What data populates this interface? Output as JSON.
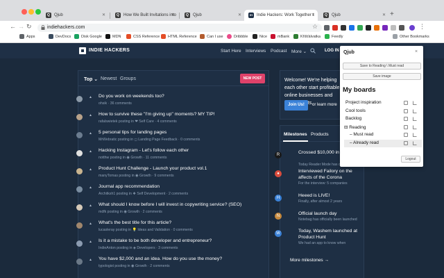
{
  "browser": {
    "tabs": [
      {
        "label": "Qjub",
        "fav_color": "#3b3b3b",
        "fav_text": "Q"
      },
      {
        "label": "How We Built Invitations into",
        "fav_color": "#3b3b3b",
        "fav_text": "Q"
      },
      {
        "label": "Qjub",
        "fav_color": "#3b3b3b",
        "fav_text": "Q"
      },
      {
        "label": "Indie Hackers: Work Together t",
        "fav_color": "#1f3046",
        "fav_text": "IH"
      },
      {
        "label": "Qjub",
        "fav_color": "#3b3b3b",
        "fav_text": "Q"
      }
    ],
    "active_tab": 3,
    "url": "indiehackers.com",
    "nav": {
      "back": "←",
      "forward": "→",
      "reload": "↻",
      "home": "⌂",
      "star": "☆",
      "menu": "⋮"
    },
    "bookmarks": [
      {
        "label": "Apps",
        "color": "#5f6368"
      },
      {
        "label": "DevDocs",
        "color": "#3a4b5e"
      },
      {
        "label": "Disk Google",
        "color": "#1aa260"
      },
      {
        "label": "MDN",
        "color": "#111111"
      },
      {
        "label": "CSS Reference",
        "color": "#e44d26"
      },
      {
        "label": "HTML Reference",
        "color": "#e44d26"
      },
      {
        "label": "Can I use",
        "color": "#b35c2e"
      },
      {
        "label": "Dribbble",
        "color": "#ea4c89"
      },
      {
        "label": "Nice",
        "color": "#222222"
      },
      {
        "label": "mBank",
        "color": "#c8102e"
      },
      {
        "label": "Křišťálvatka",
        "color": "#2e7d32"
      },
      {
        "label": "Feedly",
        "color": "#2bb24c"
      }
    ],
    "other_bookmarks": "Other Bookmarks"
  },
  "site": {
    "logo": "INDIE HACKERS",
    "nav": [
      "Start Here",
      "Interviews",
      "Podcast",
      "More ⌄"
    ],
    "login": "LOG IN",
    "feed_tabs": [
      "Top ⌄",
      "Newest",
      "Groups"
    ],
    "new_post": "NEW POST",
    "posts": [
      {
        "title": "Do you work on weekends too?",
        "meta": "ohsik · 36 comments",
        "avatar": "#8c9aa8"
      },
      {
        "title": "How to survive these \"I'm giving up\" moments? MY TIP!",
        "meta": "rafalswietek posting in ❤ Self Care · 4 comments",
        "avatar": "#b8a28a"
      },
      {
        "title": "5 personal tips for landing pages",
        "meta": "MrWebratic posting in ◻ Landing Page Feedback · 0 comments",
        "avatar": "#6b7c8f"
      },
      {
        "title": "Hacking Instagram - Let's follow each other",
        "meta": "notthw posting in ◉ Growth · 11 comments",
        "avatar": "#e0e0e0"
      },
      {
        "title": "Product Hunt Challenge - Launch your product vol.1",
        "meta": "manyTomas posting in ◉ Growth · 9 comments",
        "avatar": "#c9b48f"
      },
      {
        "title": "Journal app recommendation",
        "meta": "Architksh1 posting in ❖ Self Development · 2 comments",
        "avatar": "#7a8da0"
      },
      {
        "title": "What should I know before I will invest in copywriting service? (SEO)",
        "meta": "mdfk posting in ◉ Growth · 2 comments",
        "avatar": "#d6c9b8"
      },
      {
        "title": "What's the best title for this article?",
        "meta": "lucasleray posting in 💡 Ideas and Validation · 0 comments",
        "avatar": "#a0866c"
      },
      {
        "title": "Is it a mistake to be both developer and entrepreneur?",
        "meta": "IndieAnton posting in ◈ Developers · 3 comments",
        "avatar": "#8b9bb0"
      },
      {
        "title": "You have $2,000 and an idea. How do you use the money?",
        "meta": "typologist posting in ◉ Growth · 2 comments",
        "avatar": "#6a7887"
      }
    ],
    "welcome_text": "Welcome! We're helping each other start profitable online businesses and side projects.",
    "join_us": "Join Us!",
    "learn_more": "or learn more",
    "milestone_tabs": [
      "Milestones",
      "Products"
    ],
    "milestones": [
      {
        "title": "Crossed $10,000 in revenue!",
        "sub": "Today Reader Mode has crossed",
        "icon": "R",
        "color": "#1a1a1a"
      },
      {
        "title": "Interviewed Failory on the affects of the Corona",
        "sub": "For the interview: 5 companies",
        "icon": "●",
        "color": "#d94c3d"
      },
      {
        "title": "Heeed is LIVE!",
        "sub": "Finally, after almost 2 years",
        "icon": "H",
        "color": "#3b82d8"
      },
      {
        "title": "Official launch day",
        "sub": "Notebag has officially been launched",
        "icon": "N",
        "color": "#c78a3e"
      },
      {
        "title": "Today, Washem launched at Product Hunt",
        "sub": "We had an app to know when",
        "icon": "W",
        "color": "#3b82d8"
      }
    ],
    "more_milestones": "More milestones →"
  },
  "popup": {
    "logo": "Qjub",
    "close": "×",
    "save_reading": "Save to Reading \\ Must read",
    "save_image": "Save image",
    "title": "My boards",
    "boards": [
      {
        "label": "Project inspiration",
        "level": 0
      },
      {
        "label": "Cool tools",
        "level": 0
      },
      {
        "label": "Backlog",
        "level": 0
      },
      {
        "label": "⊟ Reading",
        "level": 0
      },
      {
        "label": "– Must read",
        "level": 1
      },
      {
        "label": "– Already read",
        "level": 1
      }
    ],
    "selected_board": 5,
    "logout": "Logout"
  }
}
